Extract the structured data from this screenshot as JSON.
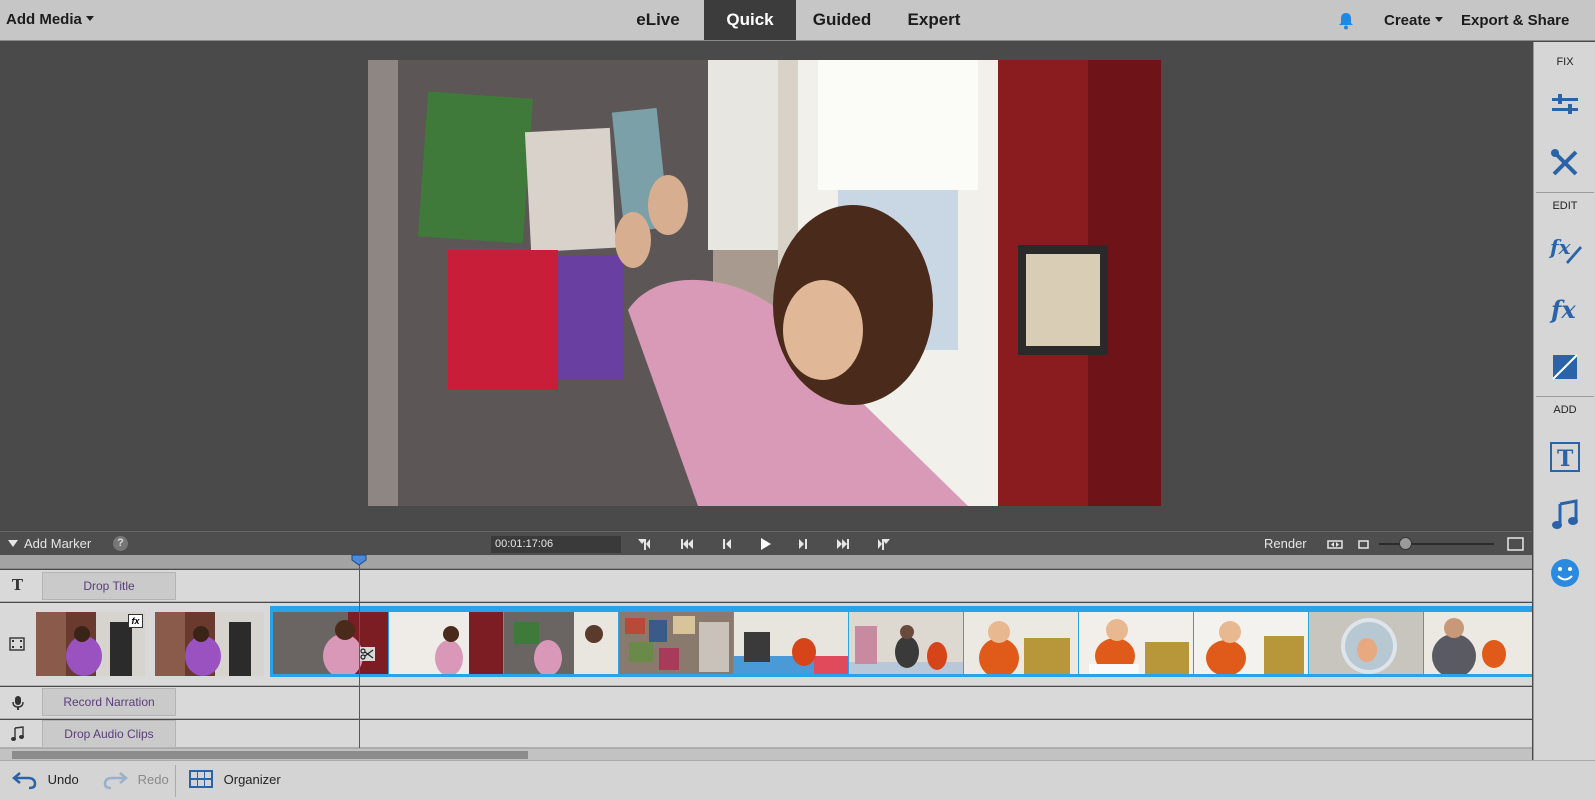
{
  "topbar": {
    "add_media": "Add Media",
    "tabs": [
      "eLive",
      "Quick",
      "Guided",
      "Expert"
    ],
    "active_tab": "Quick",
    "create": "Create",
    "export_share": "Export & Share"
  },
  "right_panel": {
    "fix_label": "FIX",
    "edit_label": "EDIT",
    "add_label": "ADD",
    "icons": [
      "adjustments-icon",
      "tools-icon",
      "fx-pencil-icon",
      "fx-icon",
      "transition-icon",
      "title-icon",
      "music-icon",
      "graphics-icon"
    ],
    "accent": "#2a63a8"
  },
  "transport": {
    "add_marker": "Add Marker",
    "help": "?",
    "timecode": "00:01:17:06",
    "render": "Render"
  },
  "timeline": {
    "drop_title": "Drop Title",
    "record_narration": "Record Narration",
    "drop_audio": "Drop Audio Clips",
    "fx_badge": "fx",
    "selection_color": "#2aa2e8",
    "playhead_color": "#e02020"
  },
  "bottombar": {
    "undo": "Undo",
    "redo": "Redo",
    "organizer": "Organizer"
  }
}
